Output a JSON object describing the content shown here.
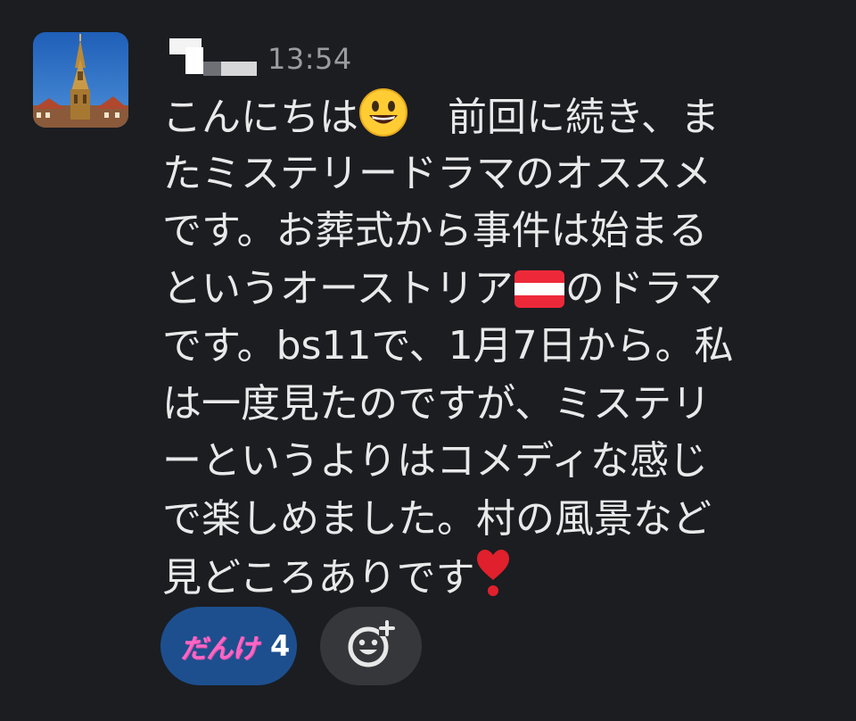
{
  "message": {
    "timestamp": "13:54",
    "lines": [
      {
        "before": "こんにちは",
        "emoji": "smiley-icon",
        "after": "　前回に続き、ま"
      },
      {
        "text": "たミステリードラマのオススメ"
      },
      {
        "text": "です。お葬式から事件は始まる"
      },
      {
        "before": "というオーストリア",
        "emoji": "austria-flag-icon",
        "after": "のドラマ"
      },
      {
        "text": "です。bs11で、1月7日から。私"
      },
      {
        "text": "は一度見たのですが、ミステリ"
      },
      {
        "text": "ーというよりはコメディな感じ"
      },
      {
        "text": "で楽しめました。村の風景など"
      },
      {
        "before": "見どころありです",
        "emoji": "heart-exclamation-icon",
        "after": ""
      }
    ]
  },
  "reactions": [
    {
      "label": "だんけ",
      "count": "4",
      "icon": "danke-custom-emoji"
    }
  ],
  "add_reaction": {
    "icon": "add-reaction-icon"
  },
  "colors": {
    "background": "#1b1d21",
    "text": "#e9e9ea",
    "timestamp": "#9a9ca0",
    "reaction_active_bg": "#1d4f8f",
    "reaction_add_bg": "#35373b",
    "danke_pink": "#ff66c4"
  }
}
